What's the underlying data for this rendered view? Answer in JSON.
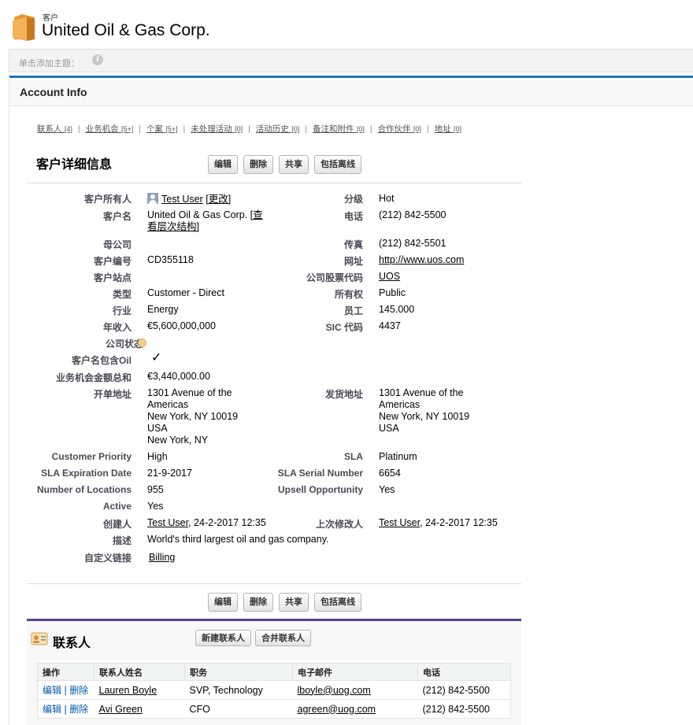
{
  "header": {
    "object_type": "客户",
    "title": "United Oil & Gas Corp."
  },
  "topic_bar": {
    "add_topic": "单击添加主题："
  },
  "section": {
    "title": "Account Info"
  },
  "related_links": [
    {
      "label": "联系人",
      "count": "[4]"
    },
    {
      "label": "业务机会",
      "count": "[5+]"
    },
    {
      "label": "个案",
      "count": "[5+]"
    },
    {
      "label": "未处理活动",
      "count": "[0]"
    },
    {
      "label": "活动历史",
      "count": "[0]"
    },
    {
      "label": "备注和附件",
      "count": "[0]"
    },
    {
      "label": "合作伙伴",
      "count": "[0]"
    },
    {
      "label": "地址",
      "count": "[0]"
    }
  ],
  "detail": {
    "title": "客户详细信息",
    "buttons": {
      "edit": "编辑",
      "delete": "删除",
      "share": "共享",
      "offline": "包括离线"
    }
  },
  "fields": {
    "owner_label": "客户所有人",
    "owner_value": "Test User",
    "owner_change": "[更改]",
    "name_label": "客户名",
    "name_value": "United Oil & Gas Corp.",
    "name_hier_1": "[查",
    "name_hier_2": "看层次结构]",
    "parent_label": "母公司",
    "number_label": "客户编号",
    "number_value": "CD355118",
    "site_label": "客户站点",
    "type_label": "类型",
    "type_value": "Customer - Direct",
    "industry_label": "行业",
    "industry_value": "Energy",
    "revenue_label": "年收入",
    "revenue_value": "€5,600,000,000",
    "status_label": "公司状态",
    "contains_oil_label": "客户名包含Oil",
    "contains_oil_value": "✓",
    "opp_total_label": "业务机会金额总和",
    "opp_total_value": "€3,440,000.00",
    "billing_label": "开单地址",
    "billing_lines": [
      "1301 Avenue of the",
      "Americas",
      "New York, NY 10019",
      "USA",
      "New York, NY"
    ],
    "priority_label": "Customer Priority",
    "priority_value": "High",
    "sla_exp_label": "SLA Expiration Date",
    "sla_exp_value": "21-9-2017",
    "locations_label": "Number of Locations",
    "locations_value": "955",
    "active_label": "Active",
    "active_value": "Yes",
    "created_label": "创建人",
    "created_user": "Test User",
    "created_time": ", 24-2-2017 12:35",
    "desc_label": "描述",
    "desc_value": "World's third largest oil and gas company.",
    "custom_links_label": "自定义链接",
    "custom_links_value": "Billing",
    "rating_label": "分级",
    "rating_value": "Hot",
    "phone_label": "电话",
    "phone_value": "(212) 842-5500",
    "fax_label": "传真",
    "fax_value": "(212) 842-5501",
    "website_label": "网址",
    "website_value": "http://www.uos.com",
    "ticker_label": "公司股票代码",
    "ticker_value": "UOS",
    "ownership_label": "所有权",
    "ownership_value": "Public",
    "employees_label": "员工",
    "employees_value": "145.000",
    "sic_label": "SIC 代码",
    "sic_value": "4437",
    "shipping_label": "发货地址",
    "shipping_lines": [
      "1301 Avenue of the",
      "Americas",
      "New York, NY 10019",
      "USA"
    ],
    "sla_label": "SLA",
    "sla_value": "Platinum",
    "sla_serial_label": "SLA Serial Number",
    "sla_serial_value": "6654",
    "upsell_label": "Upsell Opportunity",
    "upsell_value": "Yes",
    "modified_label": "上次修改人",
    "modified_user": "Test User",
    "modified_time": ", 24-2-2017 12:35"
  },
  "contacts": {
    "title": "联系人",
    "new_button": "新建联系人",
    "merge_button": "合并联系人",
    "columns": [
      "操作",
      "联系人姓名",
      "职务",
      "电子邮件",
      "电话"
    ],
    "edit_label": "编辑",
    "delete_label": "删除",
    "rows": [
      {
        "name": "Lauren Boyle",
        "title": "SVP, Technology",
        "email": "lboyle@uog.com",
        "phone": "(212) 842-5500"
      },
      {
        "name": "Avi Green",
        "title": "CFO",
        "email": "agreen@uog.com",
        "phone": "(212) 842-5500"
      }
    ]
  }
}
